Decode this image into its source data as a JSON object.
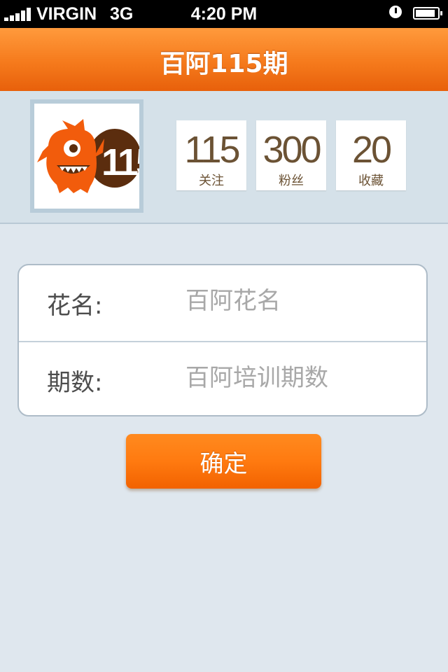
{
  "status_bar": {
    "carrier": "VIRGIN",
    "network": "3G",
    "time": "4:20 PM",
    "battery_level": 0.9
  },
  "nav": {
    "title": "百阿115期"
  },
  "profile": {
    "avatar_icon": "monster-115-logo",
    "logo_text": "115",
    "stats": [
      {
        "value": "115",
        "label": "关注"
      },
      {
        "value": "300",
        "label": "粉丝"
      },
      {
        "value": "20",
        "label": "收藏"
      }
    ]
  },
  "form": {
    "name_label": "花名:",
    "name_placeholder": "百阿花名",
    "period_label": "期数:",
    "period_placeholder": "百阿培训期数"
  },
  "actions": {
    "confirm_label": "确定"
  },
  "colors": {
    "accent": "#f57a1c",
    "stat_text": "#6b5234",
    "background": "#dfe7ee"
  }
}
